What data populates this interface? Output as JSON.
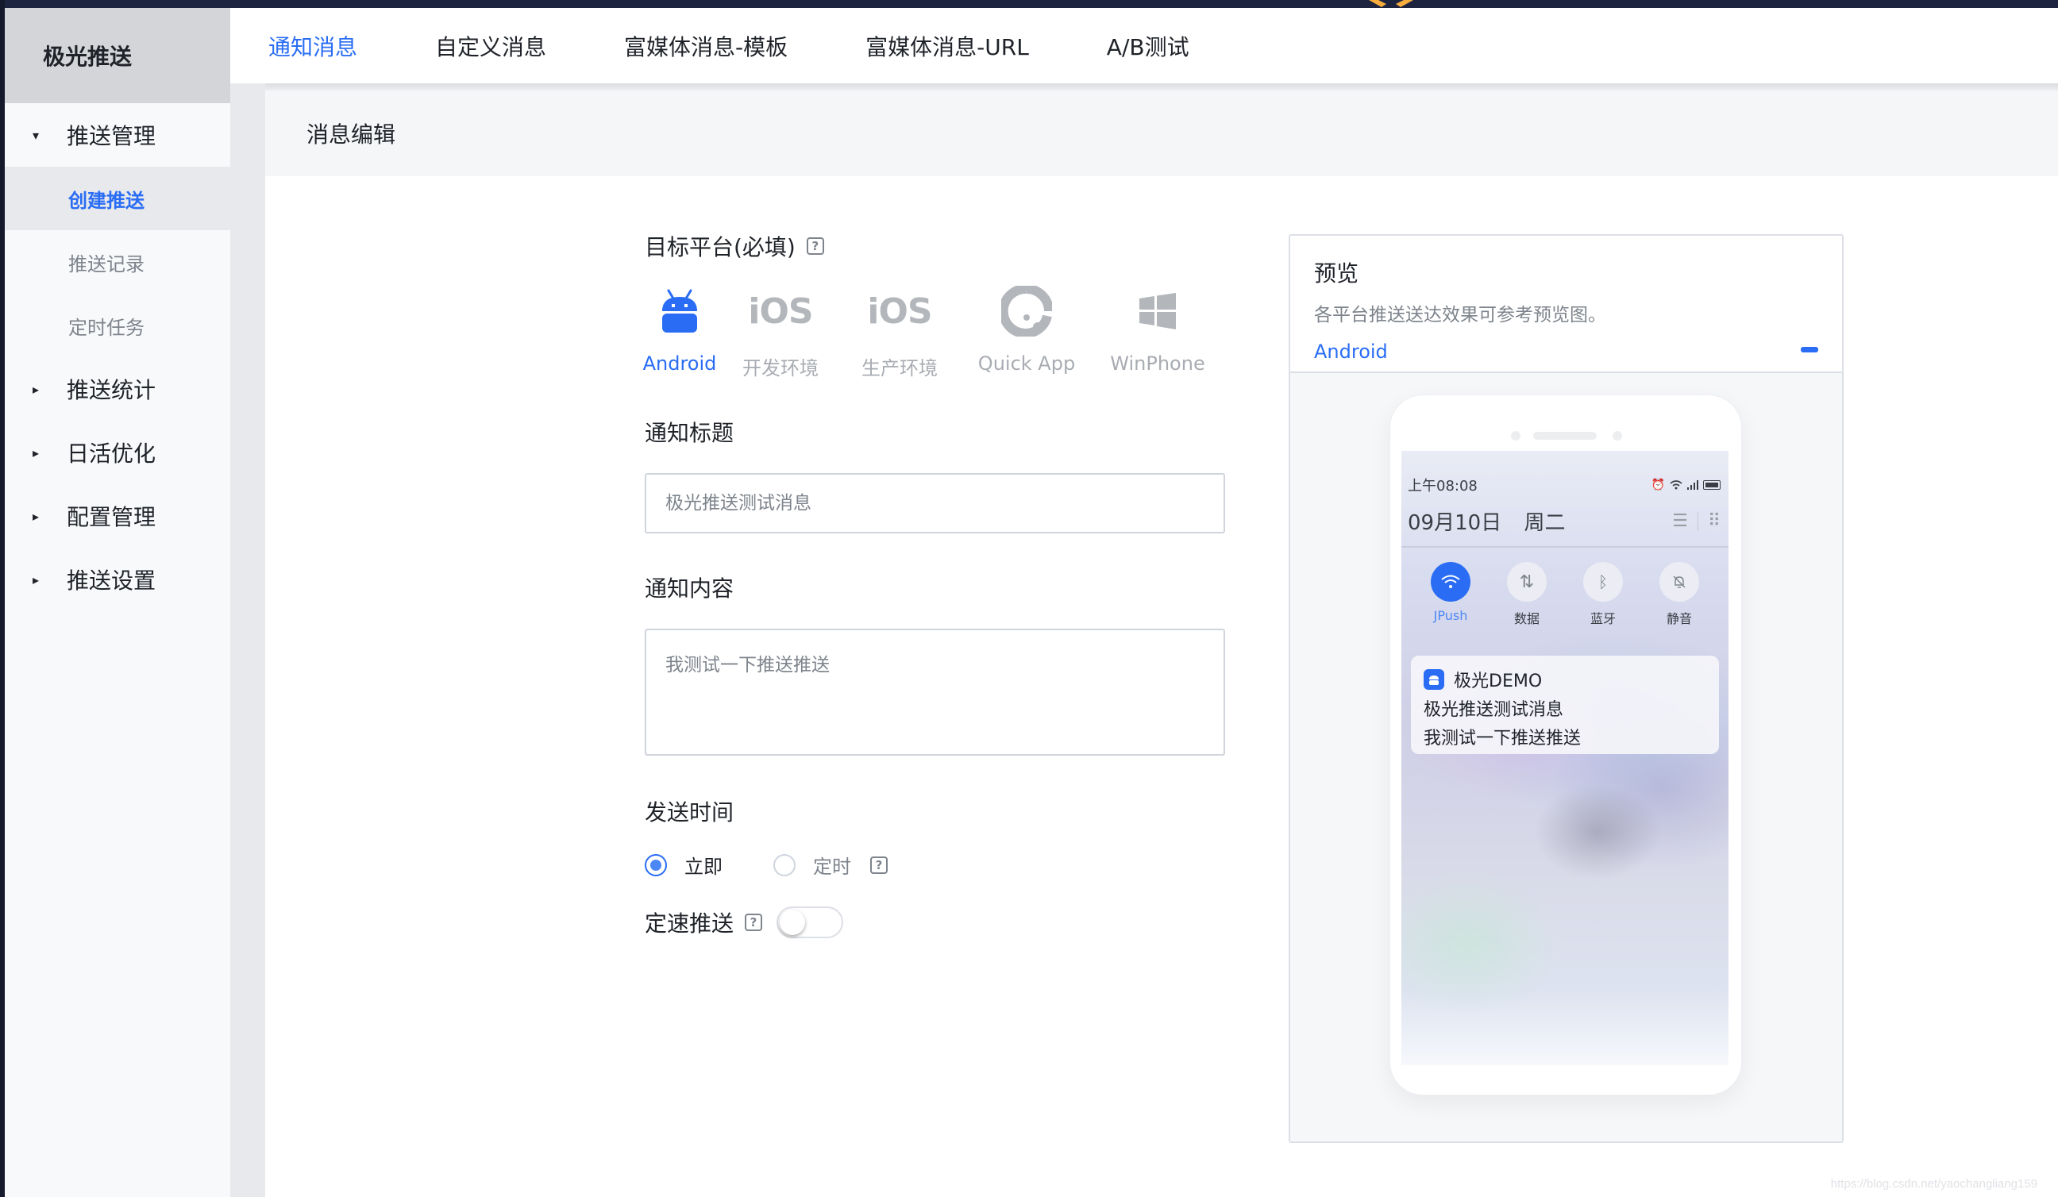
{
  "app": {
    "title": "极光推送"
  },
  "sidebar": {
    "groups": [
      {
        "label": "推送管理",
        "expanded": true,
        "children": [
          {
            "label": "创建推送",
            "active": true
          },
          {
            "label": "推送记录",
            "active": false
          },
          {
            "label": "定时任务",
            "active": false
          }
        ]
      },
      {
        "label": "推送统计",
        "expanded": false
      },
      {
        "label": "日活优化",
        "expanded": false
      },
      {
        "label": "配置管理",
        "expanded": false
      },
      {
        "label": "推送设置",
        "expanded": false
      }
    ]
  },
  "tabs": [
    {
      "label": "通知消息",
      "active": true
    },
    {
      "label": "自定义消息",
      "active": false
    },
    {
      "label": "富媒体消息-模板",
      "active": false
    },
    {
      "label": "富媒体消息-URL",
      "active": false
    },
    {
      "label": "A/B测试",
      "active": false
    }
  ],
  "section": {
    "title": "消息编辑"
  },
  "form": {
    "platform_label": "目标平台(必填)",
    "help_glyph": "?",
    "platforms": [
      {
        "label": "Android",
        "icon": "android-icon",
        "selected": true
      },
      {
        "label": "开发环境",
        "icon": "ios-icon",
        "glyph": "iOS",
        "selected": false
      },
      {
        "label": "生产环境",
        "icon": "ios-icon",
        "glyph": "iOS",
        "selected": false
      },
      {
        "label": "Quick App",
        "icon": "quick-app-icon",
        "selected": false
      },
      {
        "label": "WinPhone",
        "icon": "windows-icon",
        "selected": false
      }
    ],
    "title_label": "通知标题",
    "title_placeholder": "极光推送测试消息",
    "content_label": "通知内容",
    "content_placeholder": "我测试一下推送推送",
    "send_time_label": "发送时间",
    "send_time_options": [
      {
        "label": "立即",
        "checked": true
      },
      {
        "label": "定时",
        "checked": false
      }
    ],
    "rate_limit_label": "定速推送",
    "rate_limit_on": false
  },
  "preview": {
    "title": "预览",
    "subtitle": "各平台推送送达效果可参考预览图。",
    "platform": "Android",
    "phone": {
      "time": "上午08:08",
      "date": "09月10日",
      "weekday": "周二",
      "quick_toggles": [
        {
          "label": "JPush",
          "icon": "wifi-icon",
          "on": true
        },
        {
          "label": "数据",
          "icon": "data-arrows-icon",
          "on": false
        },
        {
          "label": "蓝牙",
          "icon": "bluetooth-icon",
          "on": false
        },
        {
          "label": "静音",
          "icon": "bell-off-icon",
          "on": false
        }
      ],
      "notification": {
        "app_name": "极光DEMO",
        "title": "极光推送测试消息",
        "body": "我测试一下推送推送"
      }
    }
  },
  "colors": {
    "accent": "#2a6df4",
    "topbar": "#1c2440",
    "sidebar_header": "#d4d5d8",
    "muted_text": "#7e848c"
  },
  "watermark": "https://blog.csdn.net/yaochangliang159"
}
